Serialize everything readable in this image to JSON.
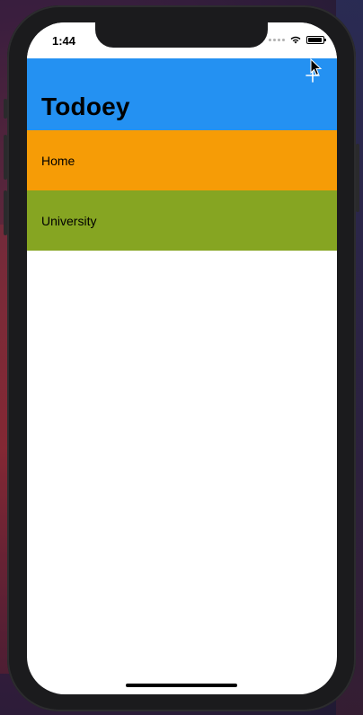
{
  "status_bar": {
    "time": "1:44"
  },
  "nav": {
    "title": "Todoey",
    "add_icon": "plus-icon",
    "background_color": "#2491F2"
  },
  "categories": [
    {
      "name": "Home",
      "color": "#F69C06"
    },
    {
      "name": "University",
      "color": "#86A522"
    }
  ]
}
